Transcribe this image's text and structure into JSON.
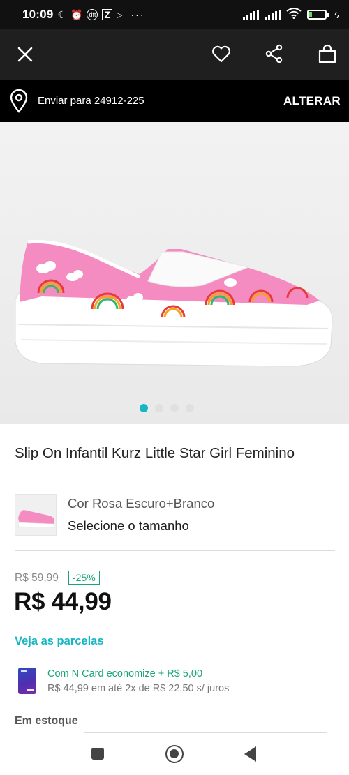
{
  "status_bar": {
    "time": "10:09",
    "battery_level": "26",
    "icons": [
      "moon-icon",
      "alarm-icon",
      "dft-icon",
      "z-app-icon",
      "play-icon",
      "more-icon",
      "signal-icon",
      "signal-icon",
      "wifi-icon",
      "battery-icon",
      "charging-icon"
    ]
  },
  "toolbar": {
    "icons": [
      "close-icon",
      "heart-icon",
      "share-icon",
      "shopping-bag-icon"
    ]
  },
  "delivery": {
    "text": "Enviar para 24912-225",
    "action": "ALTERAR",
    "icon": "location-pin-icon"
  },
  "gallery": {
    "image_count": 4,
    "active_index": 0,
    "accent_color": "#17b6c4"
  },
  "product": {
    "title": "Slip On Infantil Kurz Little Star Girl Feminino",
    "color_label": "Cor Rosa Escuro+Branco",
    "size_prompt": "Selecione o tamanho",
    "old_price": "R$ 59,99",
    "discount": "-25%",
    "price": "R$ 44,99",
    "installments_link": "Veja as parcelas"
  },
  "ncard": {
    "title": "Com N Card economize + R$ 5,00",
    "subtitle": "R$ 44,99 em até 2x de R$ 22,50 s/ juros"
  },
  "stock": {
    "label": "Em estoque"
  },
  "nav": {
    "icons": [
      "recents-icon",
      "home-icon",
      "back-icon"
    ]
  }
}
